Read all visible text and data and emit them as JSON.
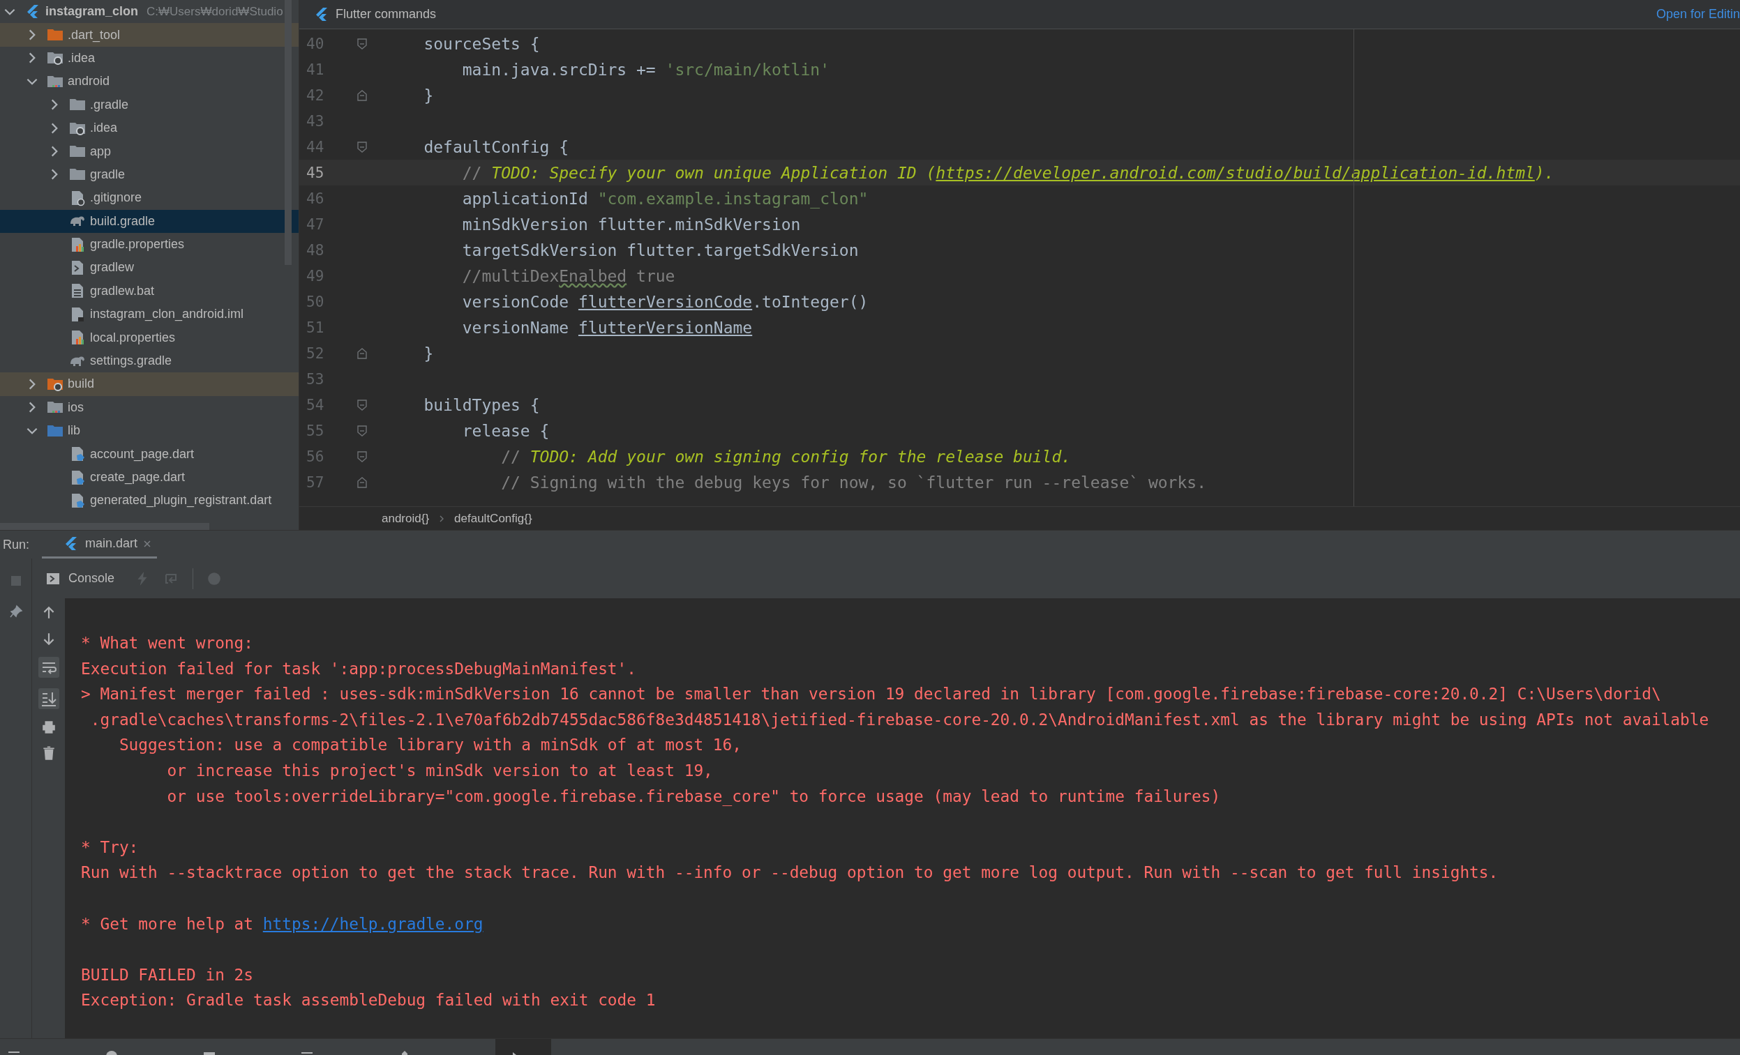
{
  "project_tree": {
    "root": {
      "label": "instagram_clon",
      "path": "C:₩Users₩dorid₩Studio",
      "expanded": true,
      "selected": false
    },
    "items": [
      {
        "label": ".dart_tool",
        "kind": "folder-excluded",
        "expanded": false,
        "selected": false
      },
      {
        "label": ".idea",
        "kind": "folder-idea",
        "expanded": false,
        "selected": false
      },
      {
        "label": "android",
        "kind": "folder-module",
        "expanded": true,
        "selected": false,
        "children": [
          {
            "label": ".gradle",
            "kind": "folder",
            "expanded": false,
            "selected": false
          },
          {
            "label": ".idea",
            "kind": "folder-idea",
            "expanded": false,
            "selected": false
          },
          {
            "label": "app",
            "kind": "folder",
            "expanded": false,
            "selected": false
          },
          {
            "label": "gradle",
            "kind": "folder",
            "expanded": false,
            "selected": false
          },
          {
            "label": ".gitignore",
            "kind": "file-ignore",
            "selected": false
          },
          {
            "label": "build.gradle",
            "kind": "file-gradle",
            "selected": true
          },
          {
            "label": "gradle.properties",
            "kind": "file-properties",
            "selected": false
          },
          {
            "label": "gradlew",
            "kind": "file-script",
            "selected": false
          },
          {
            "label": "gradlew.bat",
            "kind": "file-text",
            "selected": false
          },
          {
            "label": "instagram_clon_android.iml",
            "kind": "file-iml",
            "selected": false
          },
          {
            "label": "local.properties",
            "kind": "file-properties",
            "selected": false
          },
          {
            "label": "settings.gradle",
            "kind": "file-gradle",
            "selected": false
          }
        ]
      },
      {
        "label": "build",
        "kind": "folder-excluded-gear",
        "expanded": false,
        "selected": false
      },
      {
        "label": "ios",
        "kind": "folder-module",
        "expanded": false,
        "selected": false
      },
      {
        "label": "lib",
        "kind": "folder-source",
        "expanded": true,
        "selected": false,
        "children": [
          {
            "label": "account_page.dart",
            "kind": "file-dart",
            "selected": false
          },
          {
            "label": "create_page.dart",
            "kind": "file-dart",
            "selected": false
          },
          {
            "label": "generated_plugin_registrant.dart",
            "kind": "file-dart",
            "selected": false
          }
        ]
      }
    ]
  },
  "editor": {
    "banner": {
      "title": "Flutter commands",
      "action": "Open for Editin"
    },
    "lines": [
      {
        "number": "40",
        "fold_start": true,
        "fold_end": false,
        "current": false,
        "tokens": [
          {
            "text": "    sourceSets {",
            "kind": "plain"
          }
        ]
      },
      {
        "number": "41",
        "fold_start": false,
        "fold_end": false,
        "current": false,
        "tokens": [
          {
            "text": "        main.java.srcDirs += ",
            "kind": "plain"
          },
          {
            "text": "'src/main/kotlin'",
            "kind": "string"
          }
        ]
      },
      {
        "number": "42",
        "fold_start": false,
        "fold_end": true,
        "current": false,
        "tokens": [
          {
            "text": "    }",
            "kind": "plain"
          }
        ]
      },
      {
        "number": "43",
        "fold_start": false,
        "fold_end": false,
        "current": false
      },
      {
        "number": "44",
        "fold_start": true,
        "fold_end": false,
        "current": false,
        "tokens": [
          {
            "text": "    defaultConfig {",
            "kind": "plain"
          }
        ]
      },
      {
        "number": "45",
        "fold_start": false,
        "fold_end": false,
        "current": true,
        "tokens": [
          {
            "text": "        // ",
            "kind": "comment"
          },
          {
            "text": "TODO: Specify your own unique Application ID (",
            "kind": "todo"
          },
          {
            "text": "https://developer.android.com/studio/build/application-id.html",
            "kind": "todo-link"
          },
          {
            "text": ").",
            "kind": "todo"
          }
        ]
      },
      {
        "number": "46",
        "fold_start": false,
        "fold_end": false,
        "current": false,
        "tokens": [
          {
            "text": "        applicationId ",
            "kind": "plain"
          },
          {
            "text": "\"com.example.instagram_clon\"",
            "kind": "string"
          }
        ]
      },
      {
        "number": "47",
        "fold_start": false,
        "fold_end": false,
        "current": false,
        "tokens": [
          {
            "text": "        minSdkVersion flutter.minSdkVersion",
            "kind": "plain"
          }
        ]
      },
      {
        "number": "48",
        "fold_start": false,
        "fold_end": false,
        "current": false,
        "tokens": [
          {
            "text": "        targetSdkVersion flutter.targetSdkVersion",
            "kind": "plain"
          }
        ]
      },
      {
        "number": "49",
        "fold_start": false,
        "fold_end": false,
        "current": false,
        "tokens": [
          {
            "text": "        //multiDex",
            "kind": "comment"
          },
          {
            "text": "Enalbed",
            "kind": "typo"
          },
          {
            "text": " true",
            "kind": "comment"
          }
        ]
      },
      {
        "number": "50",
        "fold_start": false,
        "fold_end": false,
        "current": false,
        "tokens": [
          {
            "text": "        versionCode ",
            "kind": "plain"
          },
          {
            "text": "flutterVersionCode",
            "kind": "field"
          },
          {
            "text": ".toInteger()",
            "kind": "plain"
          }
        ]
      },
      {
        "number": "51",
        "fold_start": false,
        "fold_end": false,
        "current": false,
        "tokens": [
          {
            "text": "        versionName ",
            "kind": "plain"
          },
          {
            "text": "flutterVersionName",
            "kind": "field"
          }
        ]
      },
      {
        "number": "52",
        "fold_start": false,
        "fold_end": true,
        "current": false,
        "tokens": [
          {
            "text": "    }",
            "kind": "plain"
          }
        ]
      },
      {
        "number": "53",
        "fold_start": false,
        "fold_end": false,
        "current": false
      },
      {
        "number": "54",
        "fold_start": true,
        "fold_end": false,
        "current": false,
        "tokens": [
          {
            "text": "    buildTypes {",
            "kind": "plain"
          }
        ]
      },
      {
        "number": "55",
        "fold_start": true,
        "fold_end": false,
        "current": false,
        "tokens": [
          {
            "text": "        release {",
            "kind": "plain"
          }
        ]
      },
      {
        "number": "56",
        "fold_start": true,
        "fold_end": false,
        "current": false,
        "tokens": [
          {
            "text": "            // ",
            "kind": "comment"
          },
          {
            "text": "TODO: Add your own signing config for the release build.",
            "kind": "todo"
          }
        ]
      },
      {
        "number": "57",
        "fold_start": false,
        "fold_end": true,
        "current": false,
        "tokens": [
          {
            "text": "            // Signing with the debug keys for now, so `flutter run --release` works.",
            "kind": "comment"
          }
        ]
      }
    ],
    "breadcrumbs": [
      "android{}",
      "defaultConfig{}"
    ]
  },
  "run_panel": {
    "label": "Run:",
    "tabs": [
      {
        "label": "main.dart",
        "selected": true
      }
    ],
    "console_tab": "Console",
    "blocks": [
      [
        {
          "parts": [
            {
              "text": "* What went wrong:",
              "kind": "error"
            }
          ]
        },
        {
          "parts": [
            {
              "text": "Execution failed for task ':app:processDebugMainManifest'.",
              "kind": "error"
            }
          ]
        },
        {
          "parts": [
            {
              "text": "> Manifest merger failed : uses-sdk:minSdkVersion 16 cannot be smaller than version 19 declared in library [com.google.firebase:firebase-core:20.0.2] C:\\Users\\dorid\\",
              "kind": "error"
            }
          ]
        },
        {
          "parts": [
            {
              "text": " .gradle\\caches\\transforms-2\\files-2.1\\e70af6b2db7455dac586f8e3d4851418\\jetified-firebase-core-20.0.2\\AndroidManifest.xml as the library might be using APIs not available",
              "kind": "error"
            }
          ]
        },
        {
          "parts": [
            {
              "text": "    Suggestion: use a compatible library with a minSdk of at most 16,",
              "kind": "error"
            }
          ]
        },
        {
          "parts": [
            {
              "text": "         or increase this project's minSdk version to at least 19,",
              "kind": "error"
            }
          ]
        },
        {
          "parts": [
            {
              "text": "         or use tools:overrideLibrary=\"com.google.firebase.firebase_core\" to force usage (may lead to runtime failures)",
              "kind": "error"
            }
          ]
        }
      ],
      [
        {
          "parts": [
            {
              "text": "* Try:",
              "kind": "error"
            }
          ]
        },
        {
          "parts": [
            {
              "text": "Run with --stacktrace option to get the stack trace. Run with --info or --debug option to get more log output. Run with --scan to get full insights.",
              "kind": "error"
            }
          ]
        }
      ],
      [
        {
          "parts": [
            {
              "text": "* Get more help at ",
              "kind": "error"
            },
            {
              "text": "https://help.gradle.org",
              "kind": "link"
            }
          ]
        }
      ],
      [
        {
          "parts": [
            {
              "text": "BUILD FAILED in 2s",
              "kind": "error"
            }
          ]
        },
        {
          "parts": [
            {
              "text": "Exception: Gradle task assembleDebug failed with exit code 1",
              "kind": "error"
            }
          ]
        }
      ]
    ]
  }
}
